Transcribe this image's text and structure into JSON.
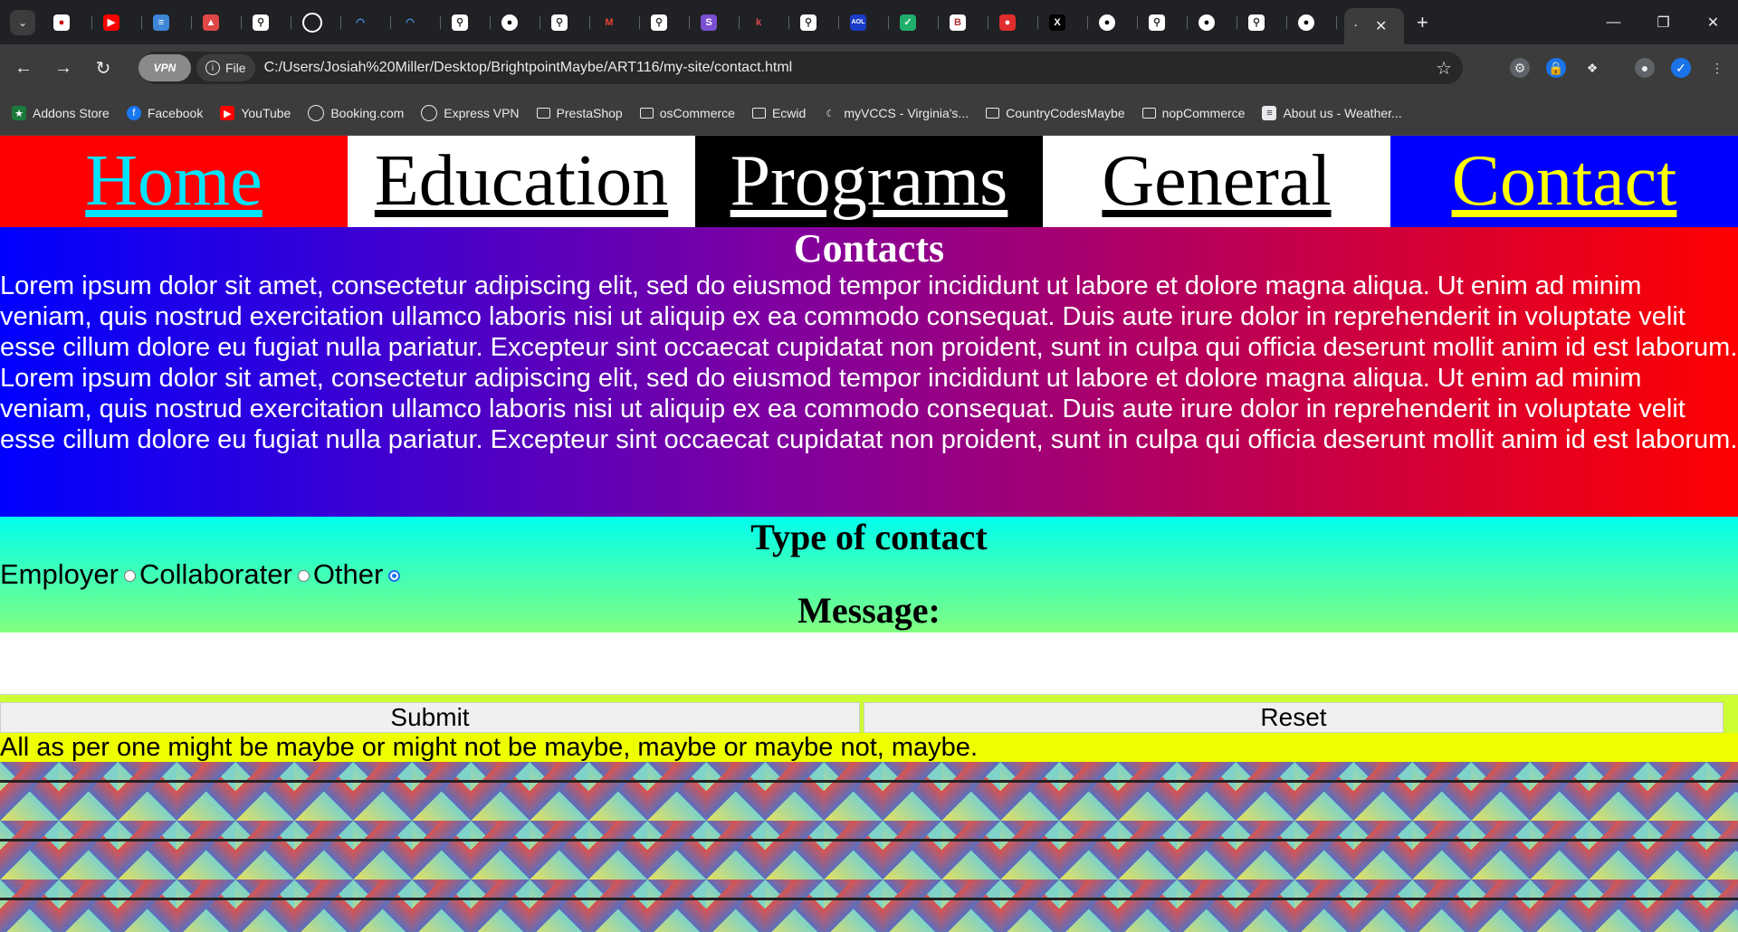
{
  "browser": {
    "tabs_icons": [
      "app-icon",
      "youtube-icon",
      "news-icon",
      "gamepad-icon",
      "search-icon",
      "clock-icon",
      "dashboard-icon",
      "dashboard-icon",
      "search-icon",
      "github-icon",
      "search-icon",
      "gmail-icon",
      "search-icon",
      "s-icon",
      "k-icon",
      "search-icon",
      "aol-icon",
      "shield-icon",
      "b-icon",
      "red-icon",
      "x-icon",
      "github-icon",
      "search-icon",
      "github-icon",
      "search-icon",
      "github-icon"
    ],
    "aol_label": "AOL",
    "vpn_label": "VPN",
    "file_label": "File",
    "url": "C:/Users/Josiah%20Miller/Desktop/BrightpointMaybe/ART116/my-site/contact.html",
    "bookmarks": [
      {
        "label": "Addons Store",
        "icon": "addons-icon"
      },
      {
        "label": "Facebook",
        "icon": "facebook-icon"
      },
      {
        "label": "YouTube",
        "icon": "youtube-icon"
      },
      {
        "label": "Booking.com",
        "icon": "globe-icon"
      },
      {
        "label": "Express VPN",
        "icon": "globe-icon"
      },
      {
        "label": "PrestaShop",
        "icon": "folder-icon"
      },
      {
        "label": "osCommerce",
        "icon": "folder-icon"
      },
      {
        "label": "Ecwid",
        "icon": "folder-icon"
      },
      {
        "label": "myVCCS - Virginia's...",
        "icon": "moon-icon"
      },
      {
        "label": "CountryCodesMaybe",
        "icon": "folder-icon"
      },
      {
        "label": "nopCommerce",
        "icon": "folder-icon"
      },
      {
        "label": "About us - Weather...",
        "icon": "page-icon"
      }
    ]
  },
  "nav": {
    "home": "Home",
    "education": "Education",
    "programs": "Programs",
    "general": "General",
    "contact": "Contact"
  },
  "contacts": {
    "heading": "Contacts",
    "paragraph1": "Lorem ipsum dolor sit amet, consectetur adipiscing elit, sed do eiusmod tempor incididunt ut labore et dolore magna aliqua. Ut enim ad minim veniam, quis nostrud exercitation ullamco laboris nisi ut aliquip ex ea commodo consequat. Duis aute irure dolor in reprehenderit in voluptate velit esse cillum dolore eu fugiat nulla pariatur. Excepteur sint occaecat cupidatat non proident, sunt in culpa qui officia deserunt mollit anim id est laborum.",
    "paragraph2": "Lorem ipsum dolor sit amet, consectetur adipiscing elit, sed do eiusmod tempor incididunt ut labore et dolore magna aliqua. Ut enim ad minim veniam, quis nostrud exercitation ullamco laboris nisi ut aliquip ex ea commodo consequat. Duis aute irure dolor in reprehenderit in voluptate velit esse cillum dolore eu fugiat nulla pariatur. Excepteur sint occaecat cupidatat non proident, sunt in culpa qui officia deserunt mollit anim id est laborum."
  },
  "form": {
    "type_heading": "Type of contact",
    "options": [
      "Employer",
      "Collaborater",
      "Other"
    ],
    "selected": "Other",
    "message_heading": "Message:",
    "message_value": "",
    "submit_label": "Submit",
    "reset_label": "Reset"
  },
  "footer": {
    "text": "All as per one might be maybe or might not be maybe, maybe or maybe not, maybe."
  },
  "colors": {
    "nav_home_bg": "#ff0000",
    "nav_contact_bg": "#0000ff",
    "footer_bg": "#eeff00"
  }
}
